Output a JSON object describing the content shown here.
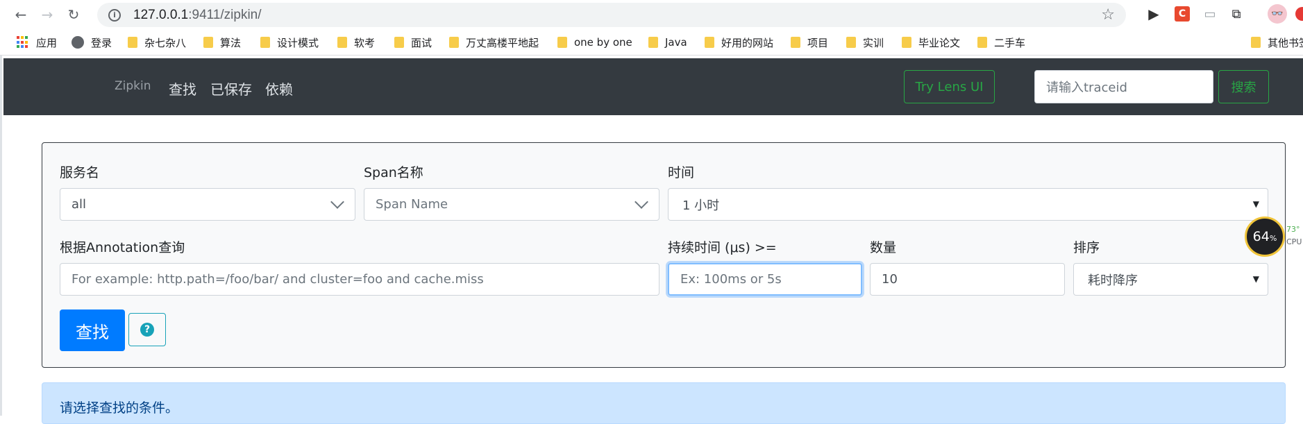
{
  "browser": {
    "url_host": "127.0.0.1",
    "url_rest": ":9411/zipkin/",
    "bookmarks": [
      "应用",
      "登录",
      "杂七杂八",
      "算法",
      "设计模式",
      "软考",
      "面试",
      "万丈高楼平地起",
      "one by one",
      "Java",
      "好用的网站",
      "项目",
      "实训",
      "毕业论文",
      "二手车",
      "其他书签"
    ]
  },
  "header": {
    "brand": "Zipkin",
    "nav": [
      "查找",
      "已保存",
      "依赖"
    ],
    "lens_button": "Try Lens UI",
    "traceid_placeholder": "请输入traceid",
    "search_button": "搜索"
  },
  "search": {
    "service_label": "服务名",
    "service_value": "all",
    "span_label": "Span名称",
    "span_placeholder": "Span Name",
    "time_label": "时间",
    "time_value": "1 小时",
    "annotation_label": "根据Annotation查询",
    "annotation_placeholder": "For example: http.path=/foo/bar/ and cluster=foo and cache.miss",
    "duration_label": "持续时间 (μs) >=",
    "duration_placeholder": "Ex: 100ms or 5s",
    "limit_label": "数量",
    "limit_value": "10",
    "sort_label": "排序",
    "sort_value": "耗时降序",
    "find_button": "查找",
    "help_icon": "question-circle-icon"
  },
  "alert": {
    "text": "请选择查找的条件。"
  },
  "overlay": {
    "cpu_percent": "64",
    "cpu_unit": "%",
    "side_value": "73°",
    "side_label": "CPU"
  },
  "colors": {
    "header_bg": "#343a40",
    "success": "#28a745",
    "primary": "#007bff",
    "info": "#17a2b8",
    "alert_bg": "#cce5ff"
  }
}
